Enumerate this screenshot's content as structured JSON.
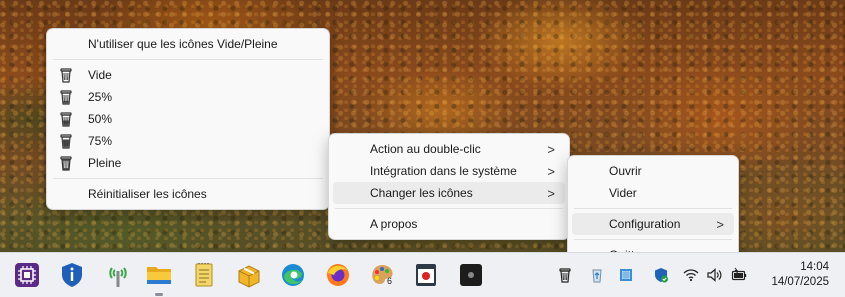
{
  "icons_menu": {
    "header": "N'utiliser que les icônes Vide/Pleine",
    "levels": [
      {
        "label": "Vide",
        "icon": "recycle-bin-empty-icon"
      },
      {
        "label": "25%",
        "icon": "recycle-bin-25-icon"
      },
      {
        "label": "50%",
        "icon": "recycle-bin-50-icon"
      },
      {
        "label": "75%",
        "icon": "recycle-bin-75-icon"
      },
      {
        "label": "Pleine",
        "icon": "recycle-bin-full-icon"
      }
    ],
    "reset": "Réinitialiser les icônes"
  },
  "main_menu": {
    "items": [
      {
        "label": "Action au double-clic",
        "submenu": true
      },
      {
        "label": "Intégration dans le système",
        "submenu": true
      },
      {
        "label": "Changer les icônes",
        "submenu": true,
        "highlighted": true
      }
    ],
    "about": "A propos"
  },
  "tray_menu": {
    "open": "Ouvrir",
    "empty": "Vider",
    "configuration": "Configuration",
    "quit": "Quitter"
  },
  "chevron": ">",
  "taskbar": {
    "apps": [
      "processor-app-icon",
      "security-shield-icon",
      "wifi-tower-icon",
      "file-explorer-icon",
      "notepad-icon",
      "package-icon",
      "edge-browser-icon",
      "firefox-icon",
      "paint-palette-icon",
      "recorder-app-icon",
      "dark-app-icon"
    ],
    "palette_badge": "6",
    "tray": [
      "recycle-bin-tray-icon",
      "recycle-bin-app-icon",
      "monitor-app-icon",
      "defender-icon",
      "wifi-icon",
      "volume-icon",
      "battery-icon"
    ],
    "time": "14:04",
    "date": "14/07/2025"
  }
}
